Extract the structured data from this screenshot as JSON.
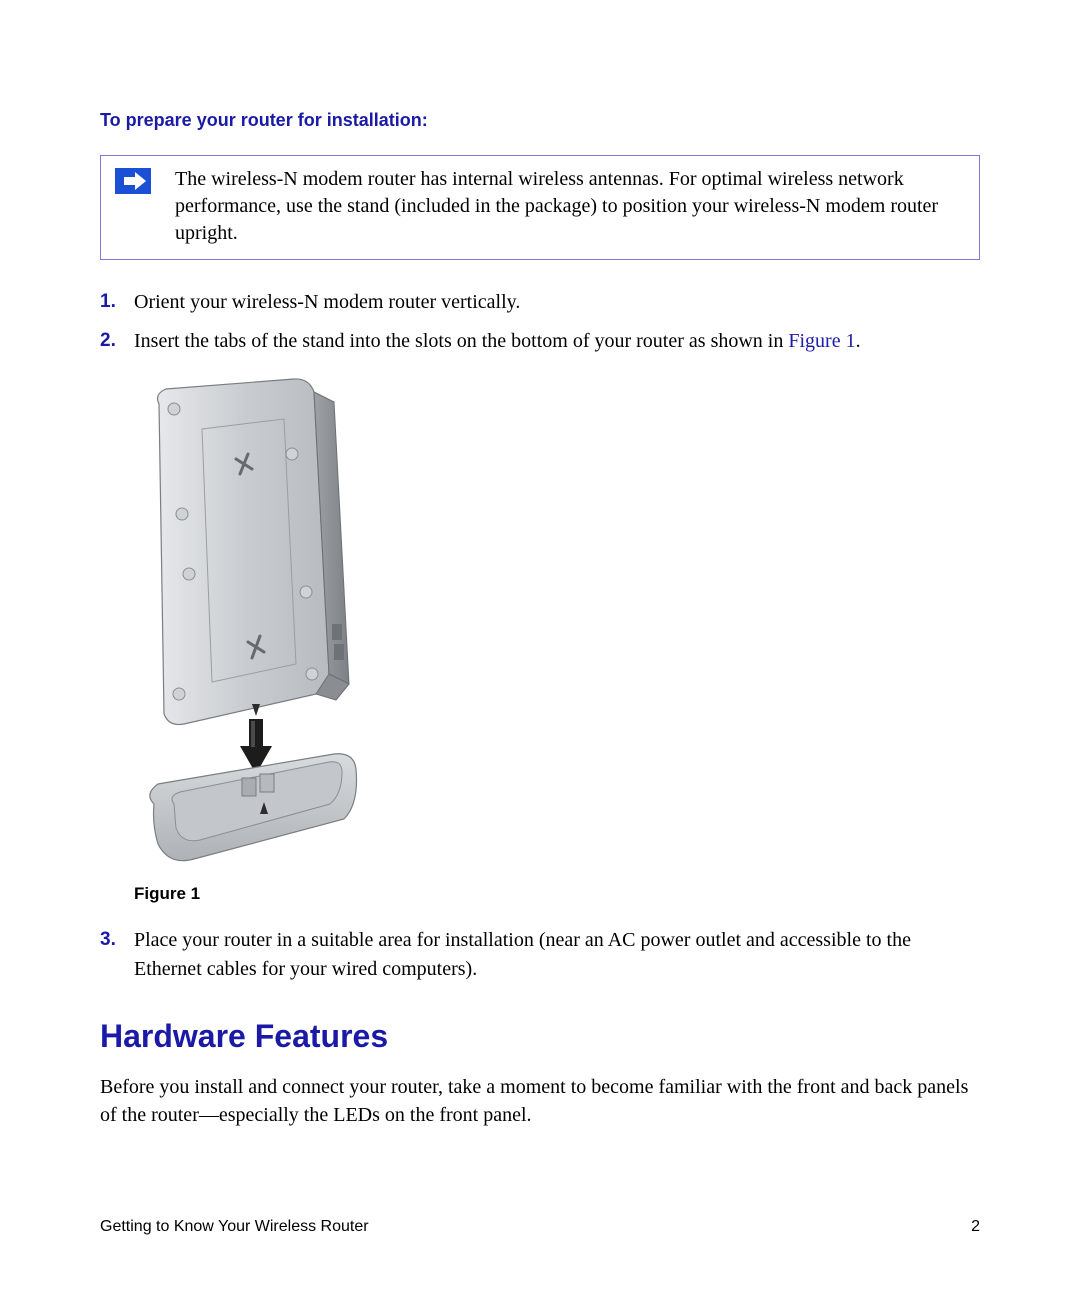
{
  "subheading": "To prepare your router for installation:",
  "note": {
    "text": "The wireless-N modem router has internal wireless antennas. For optimal wireless network performance, use the stand (included in the package) to position your wireless-N modem router upright."
  },
  "steps": {
    "s1": "Orient your wireless-N modem router vertically.",
    "s2a": "Insert the tabs of the stand into the slots on the bottom of your router as shown in ",
    "s2link": "Figure 1",
    "s2b": ".",
    "s3": "Place your router in a suitable area for installation (near an AC power outlet and accessible to the Ethernet cables for your wired computers)."
  },
  "figure_caption": "Figure 1",
  "section_heading": "Hardware Features",
  "section_body": "Before you install and connect your router, take a moment to become familiar with the front and back panels of the router—especially the LEDs on the front panel.",
  "footer": {
    "left": "Getting to Know Your Wireless Router",
    "right": "2"
  }
}
